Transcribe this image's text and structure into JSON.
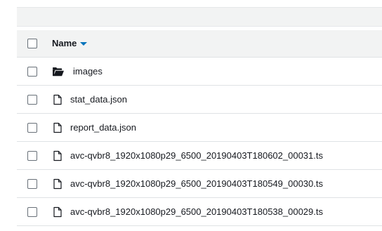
{
  "table": {
    "header": {
      "name_label": "Name",
      "sort_direction": "descending"
    },
    "rows": [
      {
        "name": "images",
        "type": "folder",
        "icon": "folder-icon"
      },
      {
        "name": "stat_data.json",
        "type": "file",
        "icon": "file-icon"
      },
      {
        "name": "report_data.json",
        "type": "file",
        "icon": "file-icon"
      },
      {
        "name": "avc-qvbr8_1920x1080p29_6500_20190403T180602_00031.ts",
        "type": "file",
        "icon": "file-icon"
      },
      {
        "name": "avc-qvbr8_1920x1080p29_6500_20190403T180549_00030.ts",
        "type": "file",
        "icon": "file-icon"
      },
      {
        "name": "avc-qvbr8_1920x1080p29_6500_20190403T180538_00029.ts",
        "type": "file",
        "icon": "file-icon"
      }
    ]
  },
  "colors": {
    "accent": "#0073bb",
    "header_bg": "#f2f3f3",
    "row_divider": "#dfe2e5",
    "text": "#16191f",
    "checkbox_border": "#687078"
  }
}
